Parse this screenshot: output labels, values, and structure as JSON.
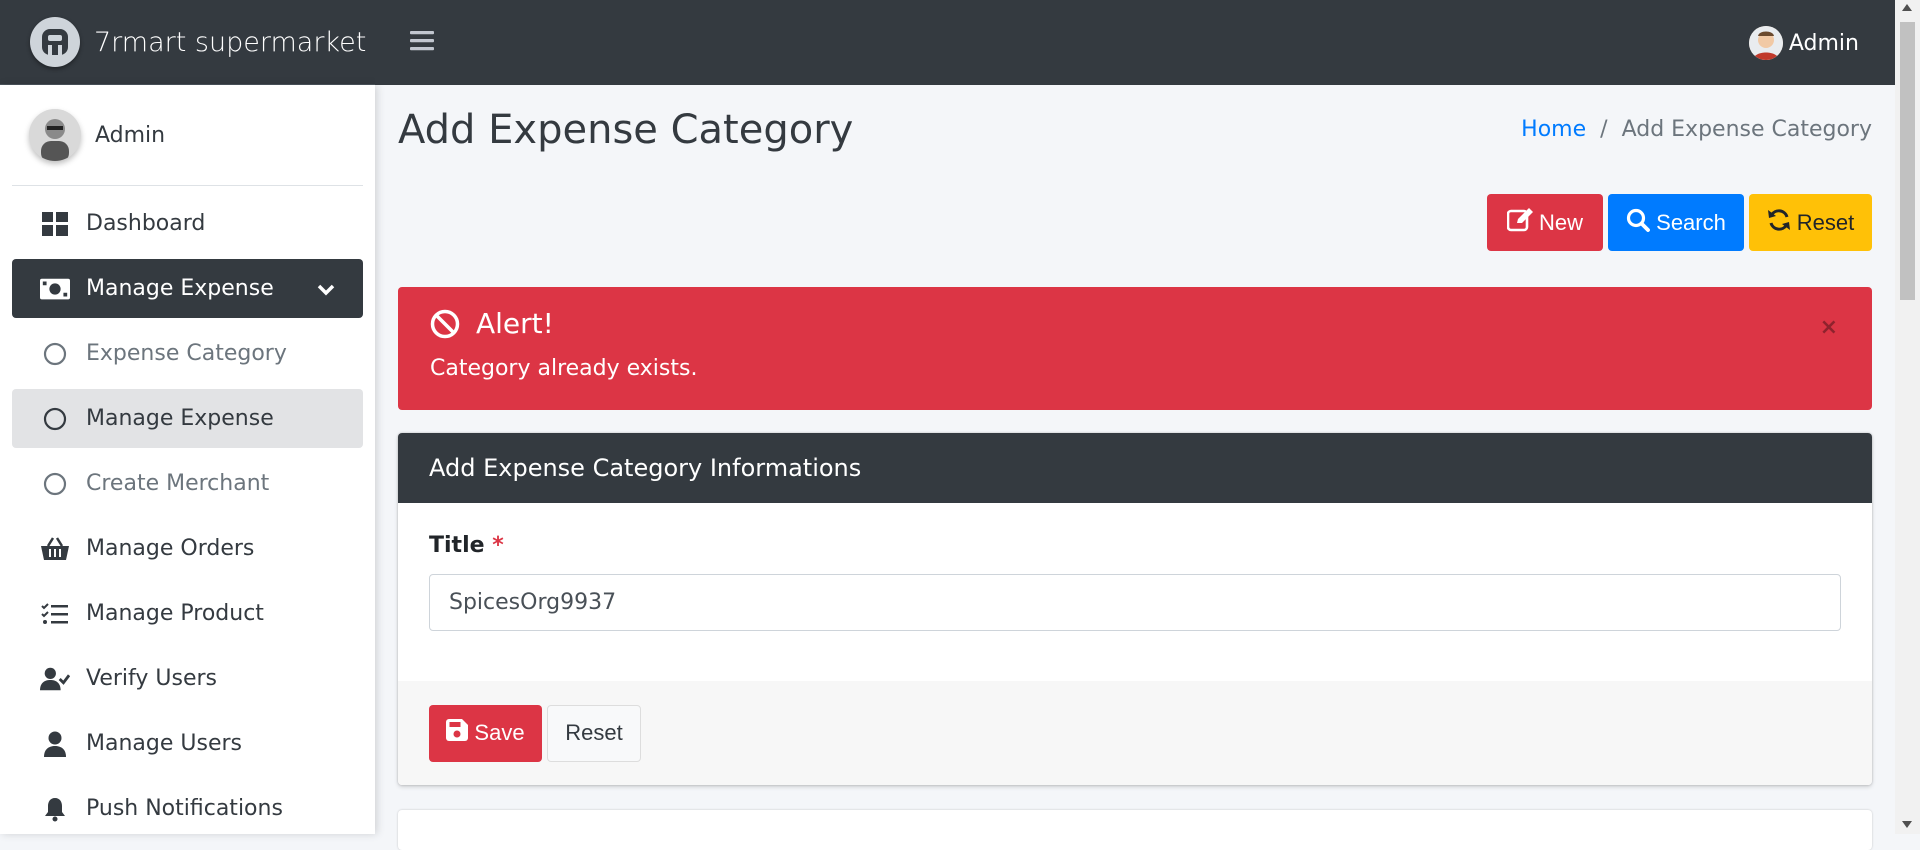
{
  "brand": {
    "name": "7rmart supermarket"
  },
  "sidebar": {
    "user_name": "Admin",
    "items": [
      {
        "label": "Dashboard",
        "icon": "dashboard-icon"
      },
      {
        "label": "Manage Expense",
        "icon": "money-bill-icon",
        "active": true
      },
      {
        "label": "Expense Category",
        "icon": "circle-icon"
      },
      {
        "label": "Manage Expense",
        "icon": "circle-icon"
      },
      {
        "label": "Create Merchant",
        "icon": "circle-icon"
      },
      {
        "label": "Manage Orders",
        "icon": "basket-icon"
      },
      {
        "label": "Manage Product",
        "icon": "list-check-icon"
      },
      {
        "label": "Verify Users",
        "icon": "user-check-icon"
      },
      {
        "label": "Manage Users",
        "icon": "user-icon"
      },
      {
        "label": "Push Notifications",
        "icon": "bell-icon"
      }
    ]
  },
  "topbar": {
    "user_name": "Admin"
  },
  "page": {
    "title": "Add Expense Category",
    "breadcrumb": {
      "home": "Home",
      "current": "Add Expense Category"
    }
  },
  "toolbar": {
    "new_label": "New",
    "search_label": "Search",
    "reset_label": "Reset"
  },
  "alert": {
    "title": "Alert!",
    "message": "Category already exists.",
    "close": "×"
  },
  "form": {
    "header": "Add Expense Category Informations",
    "title_label": "Title",
    "required_mark": "*",
    "title_value": "SpicesOrg9937",
    "save_label": "Save",
    "reset_label": "Reset"
  },
  "colors": {
    "dark": "#343a40",
    "danger": "#dc3545",
    "primary": "#007bff",
    "warning": "#ffc107"
  }
}
